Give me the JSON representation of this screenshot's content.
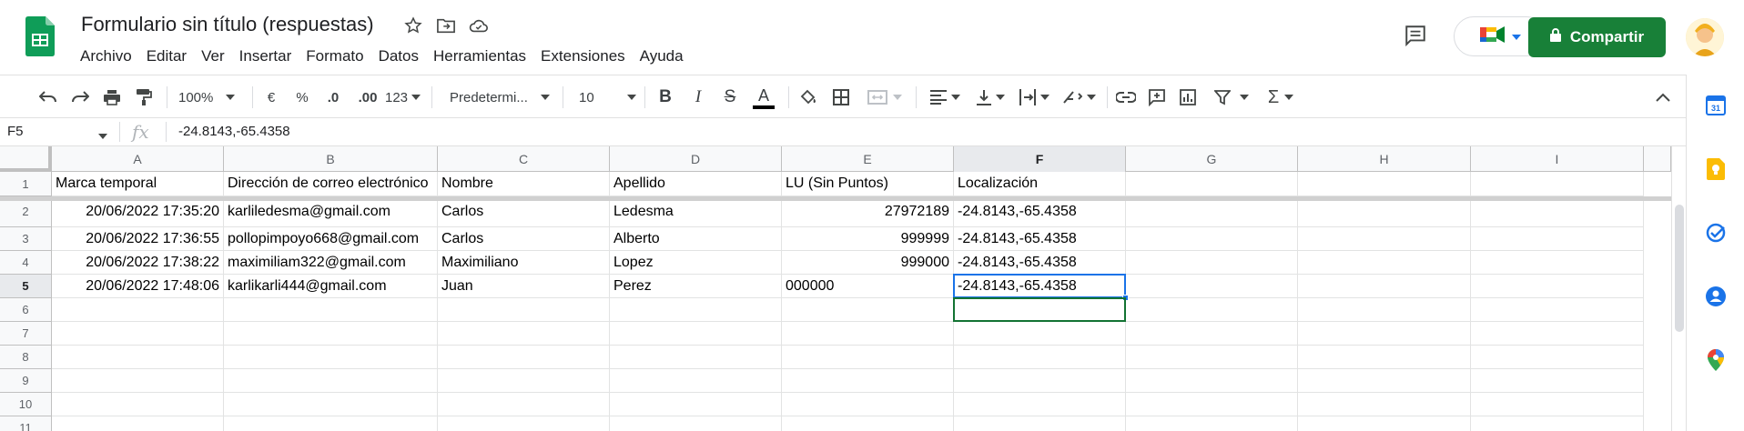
{
  "app": {
    "doc_title": "Formulario sin título (respuestas)",
    "logo_icon": "sheets-logo-icon",
    "brand_color": "#188038"
  },
  "menu": [
    "Archivo",
    "Editar",
    "Ver",
    "Insertar",
    "Formato",
    "Datos",
    "Herramientas",
    "Extensiones",
    "Ayuda"
  ],
  "header": {
    "share_label": "Compartir",
    "share_icon": "lock-icon",
    "comment_icon": "comment-icon",
    "meet_icon": "meet-icon",
    "avatar_icon": "avatar-icon"
  },
  "toolbar": {
    "zoom": "100%",
    "currency": "€",
    "percent": "%",
    "decrease_decimals": ".0",
    "increase_decimals": ".00",
    "more_formats": "123",
    "font": "Predetermi...",
    "font_size": "10",
    "bold": "B",
    "italic": "I",
    "strike": "S",
    "text_color": "A"
  },
  "formula_bar": {
    "name_box": "F5",
    "fx": "fx",
    "value": "-24.8143,-65.4358"
  },
  "grid": {
    "columns": [
      "A",
      "B",
      "C",
      "D",
      "E",
      "F",
      "G",
      "H",
      "I"
    ],
    "active_column": "F",
    "rows": [
      "1",
      "2",
      "3",
      "4",
      "5",
      "6",
      "7",
      "8",
      "9",
      "10",
      "11"
    ],
    "active_row": "5",
    "header_row": [
      "Marca temporal",
      "Dirección de correo electrónico",
      "Nombre",
      "Apellido",
      "LU (Sin Puntos)",
      "Localización"
    ],
    "data": [
      [
        "20/06/2022 17:35:20",
        "karliledesma@gmail.com",
        "Carlos",
        "Ledesma",
        "27972189",
        "-24.8143,-65.4358"
      ],
      [
        "20/06/2022 17:36:55",
        "pollopimpoyo668@gmail.com",
        "Carlos",
        "Alberto",
        "999999",
        "-24.8143,-65.4358"
      ],
      [
        "20/06/2022 17:38:22",
        "maximiliam322@gmail.com",
        "Maximiliano",
        "Lopez",
        "999000",
        "-24.8143,-65.4358"
      ],
      [
        "20/06/2022 17:48:06",
        "karlikarli444@gmail.com",
        "Juan",
        "Perez",
        "000000",
        "-24.8143,-65.4358"
      ]
    ]
  },
  "side_panel": [
    "calendar-icon",
    "keep-icon",
    "tasks-icon",
    "contacts-icon",
    "maps-icon"
  ]
}
